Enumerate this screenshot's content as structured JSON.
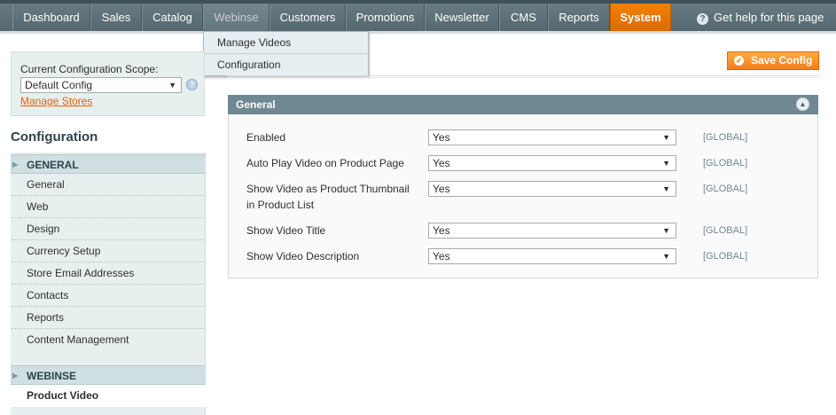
{
  "nav": {
    "items": [
      {
        "label": "Dashboard"
      },
      {
        "label": "Sales"
      },
      {
        "label": "Catalog"
      },
      {
        "label": "Webinse"
      },
      {
        "label": "Customers"
      },
      {
        "label": "Promotions"
      },
      {
        "label": "Newsletter"
      },
      {
        "label": "CMS"
      },
      {
        "label": "Reports"
      },
      {
        "label": "System"
      }
    ],
    "help_label": "Get help for this page"
  },
  "dropdown": {
    "items": [
      {
        "label": "Manage Videos"
      },
      {
        "label": "Configuration"
      }
    ]
  },
  "scope": {
    "label": "Current Configuration Scope:",
    "selected": "Default Config",
    "manage_link": "Manage Stores"
  },
  "sidebar": {
    "title": "Configuration",
    "groups": [
      {
        "label": "GENERAL",
        "items": [
          "General",
          "Web",
          "Design",
          "Currency Setup",
          "Store Email Addresses",
          "Contacts",
          "Reports",
          "Content Management"
        ]
      },
      {
        "label": "WEBINSE",
        "items": [
          "Product Video"
        ]
      }
    ]
  },
  "toolbar": {
    "save_label": "Save Config"
  },
  "section": {
    "title": "General",
    "rows": [
      {
        "label": "Enabled",
        "value": "Yes",
        "scope": "[GLOBAL]"
      },
      {
        "label": "Auto Play Video on Product Page",
        "value": "Yes",
        "scope": "[GLOBAL]"
      },
      {
        "label": "Show Video as Product Thumbnail in Product List",
        "value": "Yes",
        "scope": "[GLOBAL]"
      },
      {
        "label": "Show Video Title",
        "value": "Yes",
        "scope": "[GLOBAL]"
      },
      {
        "label": "Show Video Description",
        "value": "Yes",
        "scope": "[GLOBAL]"
      }
    ]
  },
  "colors": {
    "accent": "#eb5e00",
    "nav_bg": "#5f7178",
    "section_head": "#6f8992"
  }
}
